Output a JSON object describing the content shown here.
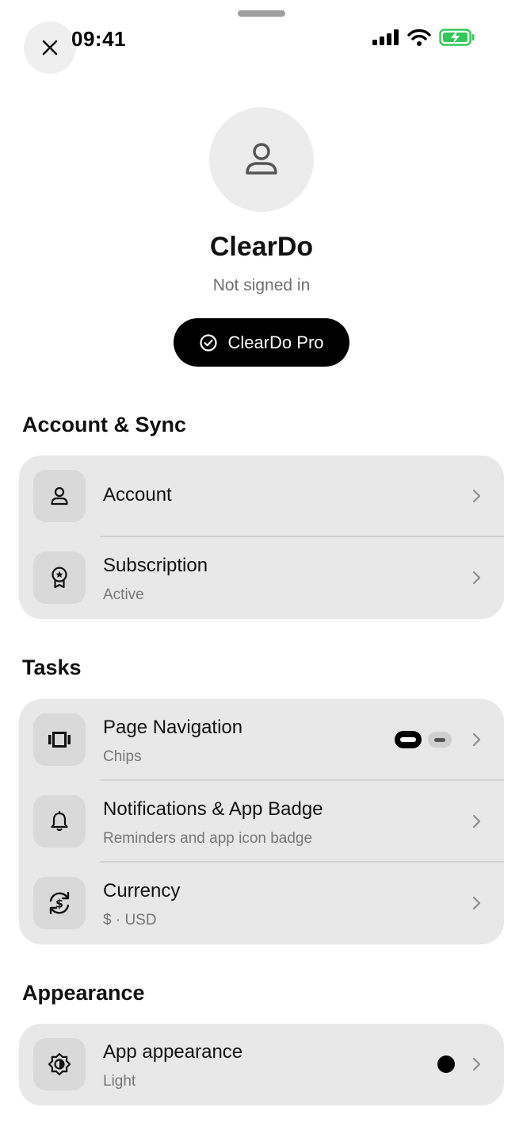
{
  "status_bar": {
    "time": "09:41"
  },
  "profile": {
    "app_name": "ClearDo",
    "sign_status": "Not signed in",
    "pro_button_label": "ClearDo Pro"
  },
  "sections": {
    "account_sync": {
      "title": "Account & Sync",
      "items": [
        {
          "label": "Account",
          "icon": "person-icon"
        },
        {
          "label": "Subscription",
          "sub": "Active",
          "icon": "award-badge-icon"
        }
      ]
    },
    "tasks": {
      "title": "Tasks",
      "items": [
        {
          "label": "Page Navigation",
          "sub": "Chips",
          "icon": "carousel-icon"
        },
        {
          "label": "Notifications & App Badge",
          "sub": "Reminders and app icon badge",
          "icon": "bell-icon"
        },
        {
          "label": "Currency",
          "sub": "$ · USD",
          "icon": "currency-exchange-icon"
        }
      ]
    },
    "appearance": {
      "title": "Appearance",
      "items": [
        {
          "label": "App appearance",
          "sub": "Light",
          "icon": "brightness-icon"
        }
      ]
    }
  },
  "colors": {
    "accent": "#000000",
    "card_background": "#e8e8e8",
    "icon_tile": "#d9d9d9",
    "battery_green": "#34c759"
  }
}
